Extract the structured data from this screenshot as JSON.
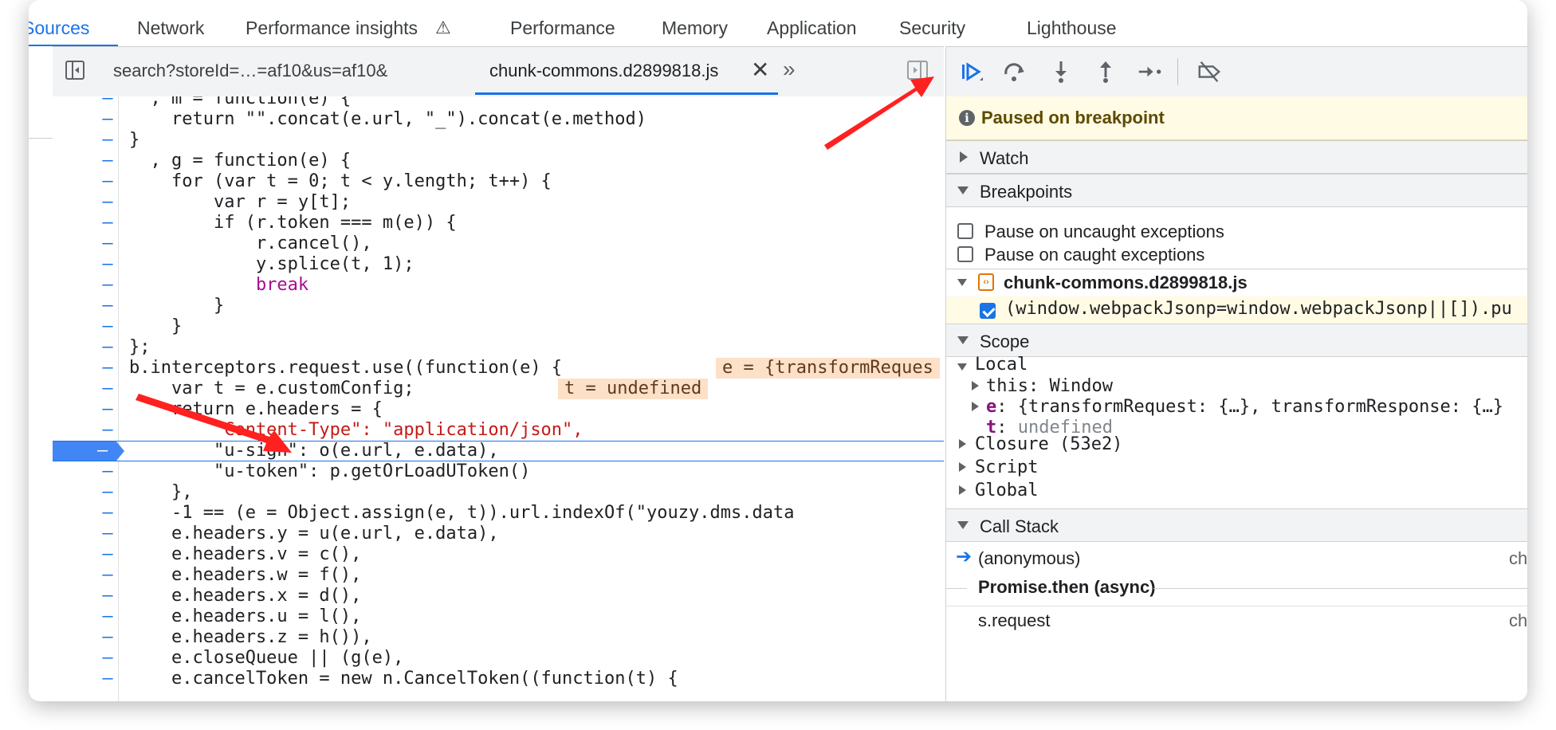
{
  "panel_tabs": [
    "Sources",
    "Network",
    "Performance insights",
    "Performance",
    "Memory",
    "Application",
    "Security",
    "Lighthouse"
  ],
  "editor_tabs": {
    "file1": "search?storeId=…=af10&us=af10&",
    "file2": "chunk-commons.d2899818.js"
  },
  "code": {
    "gutter_mark": "–",
    "lines": [
      "  , m = function(e) {",
      "    return \"\".concat(e.url, \"_\").concat(e.method)",
      "}",
      "  , g = function(e) {",
      "    for (var t = 0; t < y.length; t++) {",
      "        var r = y[t];",
      "        if (r.token === m(e)) {",
      "            r.cancel(),",
      "            y.splice(t, 1);",
      "            break",
      "        }",
      "    }",
      "};",
      "b.interceptors.request.use((function(e) {",
      "    var t = e.customConfig;",
      "    return e.headers = {",
      "        \"Content-Type\": \"application/json\",",
      "        \"u-sign\": o(e.url, e.data),",
      "        \"u-token\": p.getOrLoadUToken()",
      "    },",
      "    -1 == (e = Object.assign(e, t)).url.indexOf(\"youzy.dms.data",
      "    e.headers.y = u(e.url, e.data),",
      "    e.headers.v = c(),",
      "    e.headers.w = f(),",
      "    e.headers.x = d(),",
      "    e.headers.u = l(),",
      "    e.headers.z = h()),",
      "    e.closeQueue || (g(e),",
      "    e.cancelToken = new n.CancelToken((function(t) {"
    ],
    "inline_values": {
      "e": "e = {transformReques",
      "t": "t = undefined"
    }
  },
  "debugger": {
    "paused_message": "Paused on breakpoint",
    "sections": {
      "watch": "Watch",
      "breakpoints": "Breakpoints",
      "scope": "Scope",
      "call_stack": "Call Stack"
    },
    "pause_uncaught": "Pause on uncaught exceptions",
    "pause_caught": "Pause on caught exceptions",
    "bp_file": "chunk-commons.d2899818.js",
    "bp_code": "(window.webpackJsonp=window.webpackJsonp||[]).pu",
    "scope": {
      "local_label": "Local",
      "this_key": "this",
      "this_val": "Window",
      "e_key": "e",
      "e_val": "{transformRequest: {…}, transformResponse: {…}",
      "t_key": "t",
      "t_val": "undefined",
      "closure": "Closure (53e2)",
      "script": "Script",
      "global": "Global"
    },
    "call_stack": {
      "frame1": "(anonymous)",
      "frame1_loc": "ch",
      "async_label": "Promise.then (async)",
      "frame2": "s.request",
      "frame2_loc": "ch"
    }
  },
  "colors": {
    "accent": "#1a73e8",
    "annotation_arrow": "#ff2020",
    "paused_banner": "#fffbe5"
  }
}
